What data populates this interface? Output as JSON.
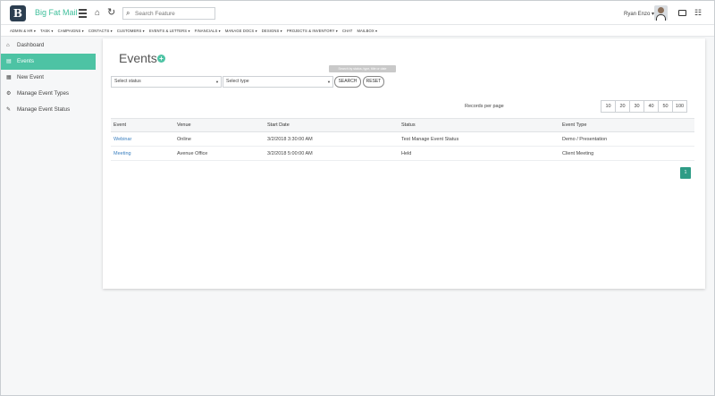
{
  "header": {
    "logo": "B",
    "brand": "Big Fat Mail",
    "search_placeholder": "Search Feature",
    "user_name": "Ryan Enzo ▾"
  },
  "menubar": [
    "ADMIN & HR ▾",
    "TASK ▾",
    "CAMPAIGNS ▾",
    "CONTACTS ▾",
    "CUSTOMERS ▾",
    "EVENTS & LETTERS ▾",
    "FINANCIALS ▾",
    "MANAGE DOCS ▾",
    "DESIGNS ▾",
    "PROJECTS & INVENTORY ▾",
    "CHAT",
    "MAILBOX ▾"
  ],
  "sidebar": {
    "items": [
      {
        "label": "Dashboard",
        "icon": "home-icon"
      },
      {
        "label": "Events",
        "icon": "list-icon"
      },
      {
        "label": "New Event",
        "icon": "calendar-icon"
      },
      {
        "label": "Manage Event Types",
        "icon": "settings-icon"
      },
      {
        "label": "Manage Event Status",
        "icon": "wrench-icon"
      }
    ]
  },
  "main": {
    "title": "Events",
    "tooltip": "Search by status, type, title or date",
    "status_select": "Select status",
    "type_select": "Select type",
    "search_button": "SEARCH",
    "reset_button": "RESET",
    "records_per_page_label": "Records per page",
    "page_sizes": [
      "10",
      "20",
      "30",
      "40",
      "50",
      "100"
    ],
    "table": {
      "headers": [
        "Event",
        "Venue",
        "Start Date",
        "Status",
        "Event Type"
      ],
      "rows": [
        [
          "Webinar",
          "Online",
          "3/2/2018 3:30:00 AM",
          "Test Manage Event Status",
          "Demo / Presentation"
        ],
        [
          "Meeting",
          "Avenue Office",
          "3/2/2018 5:00:00 AM",
          "Held",
          "Client Meeting"
        ]
      ]
    },
    "current_page": "1"
  },
  "colors": {
    "accent": "#4dc3a4",
    "pager": "#2e9c86",
    "link": "#3a7fbf"
  }
}
